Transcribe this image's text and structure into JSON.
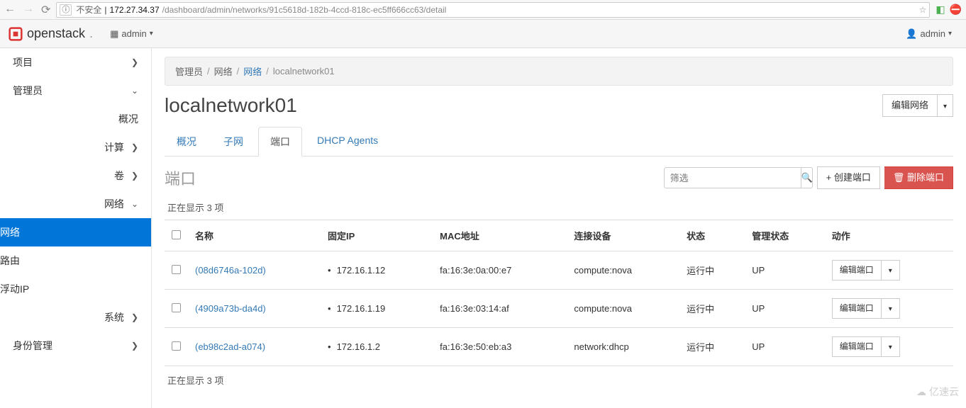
{
  "browser": {
    "unsafe_label": "不安全",
    "url_prefix": "172.27.34.37",
    "url_rest": "/dashboard/admin/networks/91c5618d-182b-4ccd-818c-ec5ff666cc63/detail"
  },
  "topbar": {
    "brand": "openstack",
    "domain": "admin",
    "user": "admin"
  },
  "sidebar": {
    "project": "项目",
    "admin": "管理员",
    "overview": "概况",
    "compute": "计算",
    "volume": "卷",
    "network_group": "网络",
    "networks": "网络",
    "routers": "路由",
    "floating_ips": "浮动IP",
    "system": "系统",
    "identity": "身份管理"
  },
  "breadcrumb": {
    "lvl1": "管理员",
    "lvl2": "网络",
    "lvl3": "网络",
    "lvl4": "localnetwork01"
  },
  "page": {
    "title": "localnetwork01",
    "edit_network": "编辑网络"
  },
  "tabs": {
    "overview": "概况",
    "subnets": "子网",
    "ports": "端口",
    "dhcp": "DHCP Agents"
  },
  "ports_panel": {
    "heading": "端口",
    "filter_placeholder": "筛选",
    "create_port": "+ 创建端口",
    "delete_ports": "删除端口",
    "showing": "正在显示 3 项",
    "columns": {
      "name": "名称",
      "fixed_ip": "固定IP",
      "mac": "MAC地址",
      "device": "连接设备",
      "status": "状态",
      "admin_state": "管理状态",
      "actions": "动作"
    },
    "rows": [
      {
        "name": "(08d6746a-102d)",
        "ip": "172.16.1.12",
        "mac": "fa:16:3e:0a:00:e7",
        "device": "compute:nova",
        "status": "运行中",
        "admin": "UP",
        "action": "编辑端口"
      },
      {
        "name": "(4909a73b-da4d)",
        "ip": "172.16.1.19",
        "mac": "fa:16:3e:03:14:af",
        "device": "compute:nova",
        "status": "运行中",
        "admin": "UP",
        "action": "编辑端口"
      },
      {
        "name": "(eb98c2ad-a074)",
        "ip": "172.16.1.2",
        "mac": "fa:16:3e:50:eb:a3",
        "device": "network:dhcp",
        "status": "运行中",
        "admin": "UP",
        "action": "编辑端口"
      }
    ]
  },
  "watermark": "亿速云",
  "icons": {
    "trash": "🗑",
    "search": "🔍",
    "user": "👤"
  }
}
